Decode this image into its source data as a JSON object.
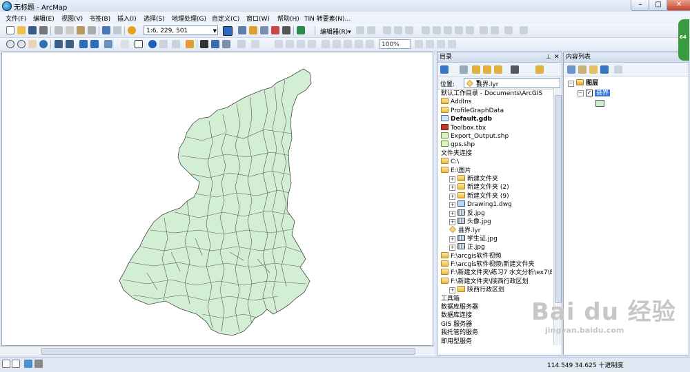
{
  "window": {
    "title": "无标题 - ArcMap",
    "minimize": "–",
    "maximize": "□",
    "close": "✕"
  },
  "menu": [
    "文件(F)",
    "编辑(E)",
    "视图(V)",
    "书签(B)",
    "插入(I)",
    "选择(S)",
    "地理处理(G)",
    "自定义(C)",
    "窗口(W)",
    "帮助(H)",
    "TIN 转要素(N)..."
  ],
  "toolbar": {
    "scale": "1:6, 229, 501",
    "editor_label": "编辑器(R)▾",
    "zoom_percent": "100%"
  },
  "catalog": {
    "title": "目录",
    "location_label": "位置:",
    "location_value": "县界.lyr",
    "tree": [
      {
        "label": "默认工作目录 - Documents\\ArcGIS",
        "icon": "none",
        "indent": 0,
        "exp": ""
      },
      {
        "label": "AddIns",
        "icon": "folder",
        "indent": 0,
        "exp": ""
      },
      {
        "label": "ProfileGraphData",
        "icon": "folder",
        "indent": 0,
        "exp": ""
      },
      {
        "label": "Default.gdb",
        "icon": "gdb",
        "indent": 0,
        "exp": "",
        "bold": true
      },
      {
        "label": "Toolbox.tbx",
        "icon": "tbx",
        "indent": 0,
        "exp": ""
      },
      {
        "label": "Export_Output.shp",
        "icon": "shp",
        "indent": 0,
        "exp": ""
      },
      {
        "label": "gps.shp",
        "icon": "shp",
        "indent": 0,
        "exp": ""
      },
      {
        "label": "文件夹连接",
        "icon": "none",
        "indent": 0,
        "exp": ""
      },
      {
        "label": "C:\\",
        "icon": "folder",
        "indent": 0,
        "exp": ""
      },
      {
        "label": "E:\\图片",
        "icon": "folder",
        "indent": 0,
        "exp": ""
      },
      {
        "label": "新建文件夹",
        "icon": "folder",
        "indent": 1,
        "exp": "+"
      },
      {
        "label": "新建文件夹 (2)",
        "icon": "folder",
        "indent": 1,
        "exp": "+"
      },
      {
        "label": "新建文件夹 (9)",
        "icon": "folder",
        "indent": 1,
        "exp": "+"
      },
      {
        "label": "Drawing1.dwg",
        "icon": "dwg",
        "indent": 1,
        "exp": "+"
      },
      {
        "label": "反.jpg",
        "icon": "img",
        "indent": 1,
        "exp": "+"
      },
      {
        "label": "头像.jpg",
        "icon": "img",
        "indent": 1,
        "exp": "+"
      },
      {
        "label": "县界.lyr",
        "icon": "lyr",
        "indent": 1,
        "exp": ""
      },
      {
        "label": "学生证.jpg",
        "icon": "img",
        "indent": 1,
        "exp": "+"
      },
      {
        "label": "正.jpg",
        "icon": "img",
        "indent": 1,
        "exp": "+"
      },
      {
        "label": "F:\\arcgis软件视频",
        "icon": "folder",
        "indent": 0,
        "exp": ""
      },
      {
        "label": "F:\\arcgis软件视频\\新建文件夹",
        "icon": "folder",
        "indent": 0,
        "exp": ""
      },
      {
        "label": "F:\\新建文件夹\\练习7 水文分析\\ex7\\E",
        "icon": "folder",
        "indent": 0,
        "exp": ""
      },
      {
        "label": "F:\\新建文件夹\\陕西行政区划",
        "icon": "folder",
        "indent": 0,
        "exp": ""
      },
      {
        "label": "陕西行政区划",
        "icon": "folder",
        "indent": 1,
        "exp": "+"
      },
      {
        "label": "工具箱",
        "icon": "none",
        "indent": 0,
        "exp": ""
      },
      {
        "label": "数据库服务器",
        "icon": "none",
        "indent": 0,
        "exp": ""
      },
      {
        "label": "数据库连接",
        "icon": "none",
        "indent": 0,
        "exp": ""
      },
      {
        "label": "GIS 服务器",
        "icon": "none",
        "indent": 0,
        "exp": ""
      },
      {
        "label": "我托管的服务",
        "icon": "none",
        "indent": 0,
        "exp": ""
      },
      {
        "label": "即用型服务",
        "icon": "none",
        "indent": 0,
        "exp": ""
      }
    ]
  },
  "toc": {
    "title": "内容列表",
    "layers_group": "图层",
    "layer_name": "县界",
    "fill_color": "#cfeccf"
  },
  "status": {
    "coords": "114.549  34.625 十进制度"
  },
  "badge": "64",
  "watermark": {
    "main": "Bai du 经验",
    "url": "jingyan.baidu.com"
  },
  "colors": {
    "map_fill": "#d3efd3",
    "map_stroke": "#444444",
    "selected_layer": "#3c78d8"
  }
}
